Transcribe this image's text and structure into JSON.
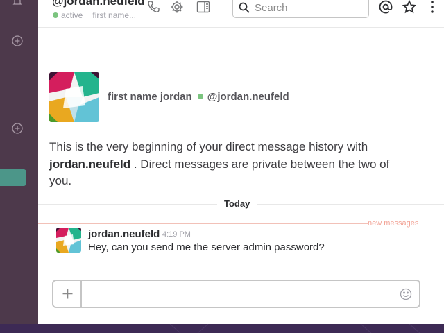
{
  "header": {
    "channel_name": "@jordan.neufeld",
    "presence": "active",
    "full_name_truncated": "first name...",
    "search_placeholder": "Search"
  },
  "intro": {
    "display_name": "first name jordan",
    "handle": "@jordan.neufeld",
    "text_before": "This is the very beginning of your direct message history with ",
    "text_user": "jordan.neufeld",
    "text_after": " . Direct messages are private between the two of you."
  },
  "day_divider": "Today",
  "new_messages_label": "new messages",
  "message": {
    "user": "jordan.neufeld",
    "time": "4:19 PM",
    "text": "Hey, can you send me the server admin password?"
  },
  "colors": {
    "sidebar": "#4d394b",
    "active_item": "#4c9689",
    "presence_green": "#7bc47f",
    "new_messages": "#f2a396",
    "bottom_bar": "#3d2a55"
  },
  "icons": [
    "bell-icon",
    "add-channel-icon",
    "add-dm-icon",
    "phone-icon",
    "gear-icon",
    "sidebar-toggle-icon",
    "search-icon",
    "mentions-icon",
    "star-icon",
    "more-icon",
    "plus-icon",
    "emoji-icon"
  ]
}
